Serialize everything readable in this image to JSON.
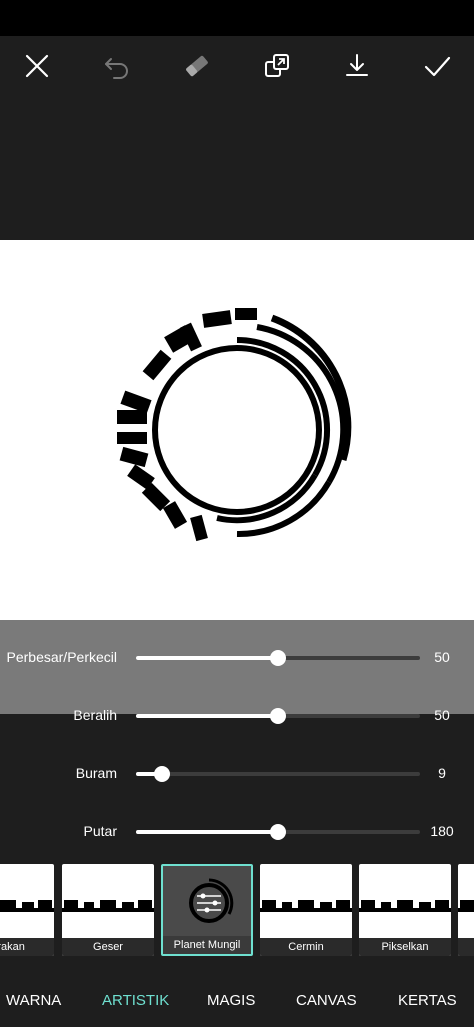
{
  "colors": {
    "accent": "#6fe0d0",
    "highlight": "#7a7a7a",
    "background": "#1e1e1e",
    "canvas": "#ffffff"
  },
  "toolbar": {
    "icons": [
      "close-icon",
      "undo-icon",
      "eraser-icon",
      "compare-icon",
      "download-icon",
      "check-icon"
    ]
  },
  "sliders": [
    {
      "label": "Perbesar/Perkecil",
      "value": "50",
      "fraction": 0.5
    },
    {
      "label": "Beralih",
      "value": "50",
      "fraction": 0.5
    },
    {
      "label": "Buram",
      "value": "9",
      "fraction": 0.09
    },
    {
      "label": "Putar",
      "value": "180",
      "fraction": 0.5
    }
  ],
  "effects": [
    {
      "label": "erakan"
    },
    {
      "label": "Geser"
    },
    {
      "label": "Planet Mungil",
      "selected": true
    },
    {
      "label": "Cermin"
    },
    {
      "label": "Pikselkan"
    },
    {
      "label": ""
    }
  ],
  "tabs": [
    {
      "label": "WARNA",
      "active": false
    },
    {
      "label": "ARTISTIK",
      "active": true
    },
    {
      "label": "MAGIS",
      "active": false
    },
    {
      "label": "CANVAS",
      "active": false
    },
    {
      "label": "KERTAS",
      "active": false
    }
  ]
}
